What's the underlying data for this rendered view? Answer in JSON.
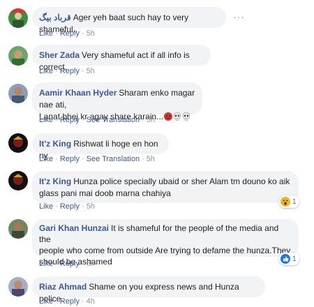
{
  "comments": [
    {
      "author": "قرباد بیگ",
      "text": "Ager yeh baat such hay to very shameful..",
      "like": "Like",
      "reply": "Reply",
      "time": "5h"
    },
    {
      "author": "Sher Zada",
      "text": "Very shameful act if all info is correct.",
      "like": "Like",
      "reply": "Reply",
      "time": "5h"
    },
    {
      "author": "Aamir Khaan Hyder",
      "text_line1": "Sharam enko magar nae ati,",
      "text_line2": "Lanat bhej kr agay share karain...",
      "like": "Like",
      "reply": "Reply",
      "see_translation": "See Translation",
      "time": "5h"
    },
    {
      "author": "It'z King",
      "text": "Rishwat li hoge en hon ny",
      "like": "Like",
      "reply": "Reply",
      "see_translation": "See Translation",
      "time": "5h"
    },
    {
      "author": "It'z King",
      "text_line1": "Hunza police specially ubaid or sher Alam tm douno ko aik",
      "text_line2": "glass pani mai doob marna chahiya",
      "like": "Like",
      "reply": "Reply",
      "time": "5h",
      "reaction_count": "1"
    },
    {
      "author": "Gari Khan Hunzai",
      "text_line1": "It is shameful for the people of the media and the",
      "text_line2": "people who come from outside Are trying to defame the hunza.They",
      "text_line3": "should be ashamed",
      "like": "Like",
      "reply": "Reply",
      "time": "5h",
      "reaction_count": "1"
    },
    {
      "author": "Riaz Ahmad",
      "text": "Shame on you express news and Hunza police.",
      "like": "Like",
      "reply": "Reply",
      "time": "4h"
    }
  ],
  "more_options": "···",
  "separator": "·",
  "icons": {
    "more": "more-options-icon",
    "wow_reaction": "wow-reaction-icon",
    "like_reaction": "like-reaction-icon",
    "angry_emoji": "angry-emoji-icon",
    "skull_emoji": "skull-emoji-icon"
  },
  "colors": {
    "author": "#385898",
    "bubble": "#f2f3f5",
    "meta": "#90949c",
    "like_blue": "#1877f2",
    "wow_yellow": "#f7b125"
  }
}
